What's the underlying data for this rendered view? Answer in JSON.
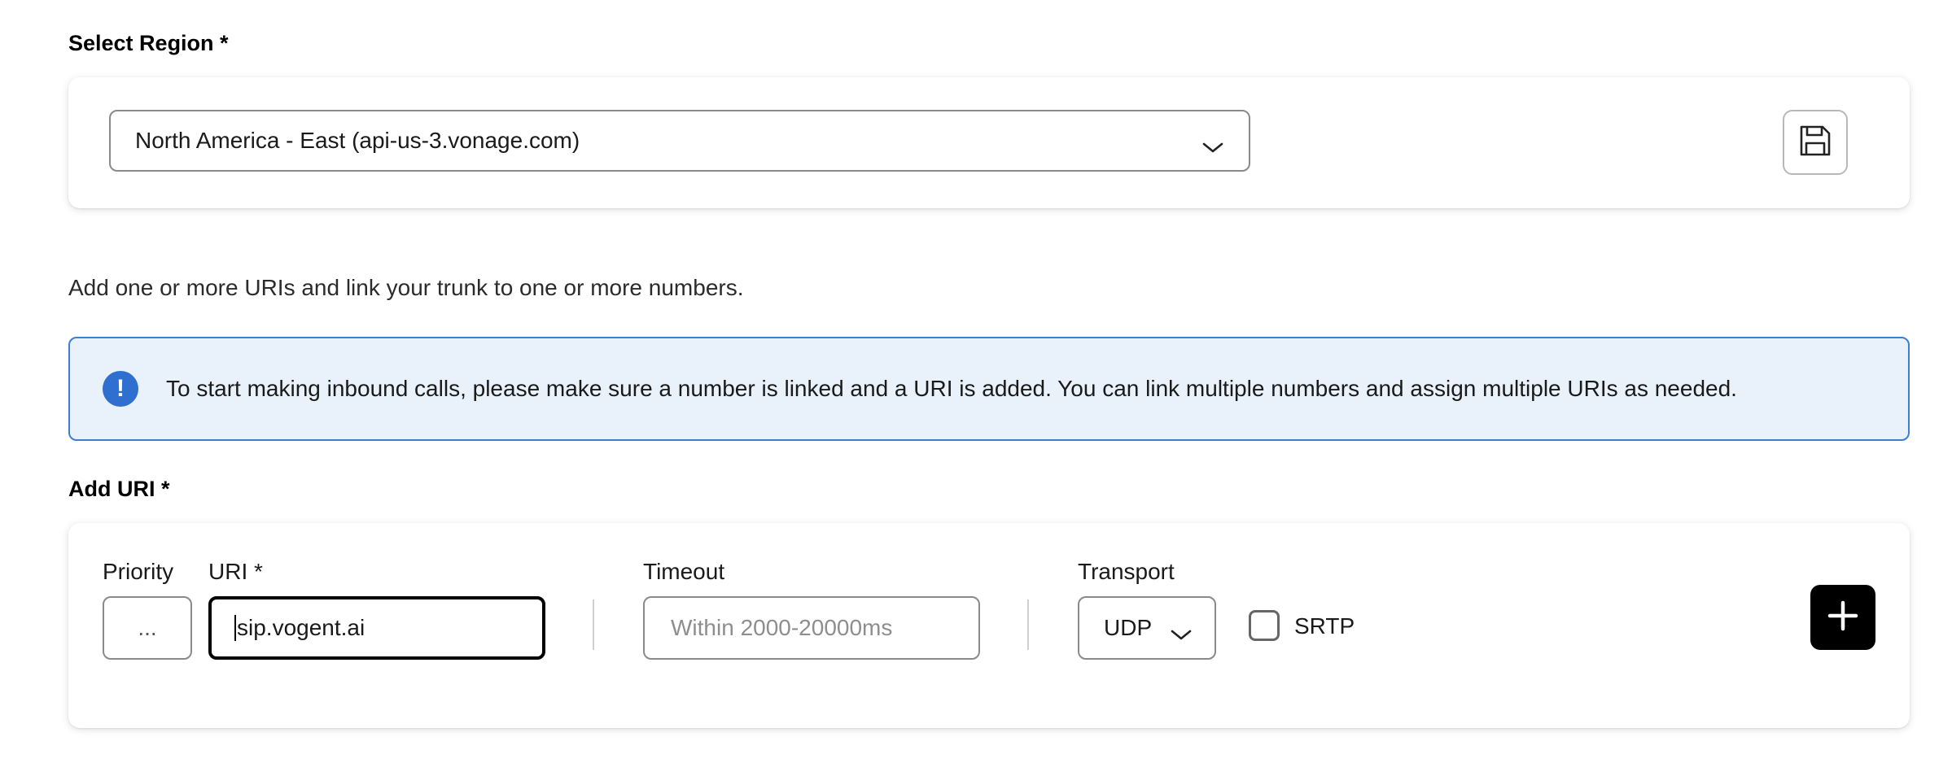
{
  "region": {
    "label": "Select Region *",
    "selected": "North America - East (api-us-3.vonage.com)",
    "save_icon": "floppy-disk-icon"
  },
  "description": "Add one or more URIs and link your trunk to one or more numbers.",
  "alert": {
    "icon": "exclamation-icon",
    "text": "To start making inbound calls, please make sure a number is linked and a URI is added. You can link multiple numbers and assign multiple URIs as needed."
  },
  "add_uri": {
    "label": "Add URI *",
    "priority": {
      "label": "Priority",
      "value": "..."
    },
    "uri": {
      "label": "URI *",
      "value": "sip.vogent.ai"
    },
    "timeout": {
      "label": "Timeout",
      "placeholder": "Within 2000-20000ms"
    },
    "transport": {
      "label": "Transport",
      "selected": "UDP"
    },
    "srtp": {
      "label": "SRTP",
      "checked": false
    },
    "add_icon": "plus-icon"
  },
  "colors": {
    "accent": "#2f6fd0",
    "alert_bg": "#e9f2fb",
    "alert_border": "#3d7fcf"
  }
}
